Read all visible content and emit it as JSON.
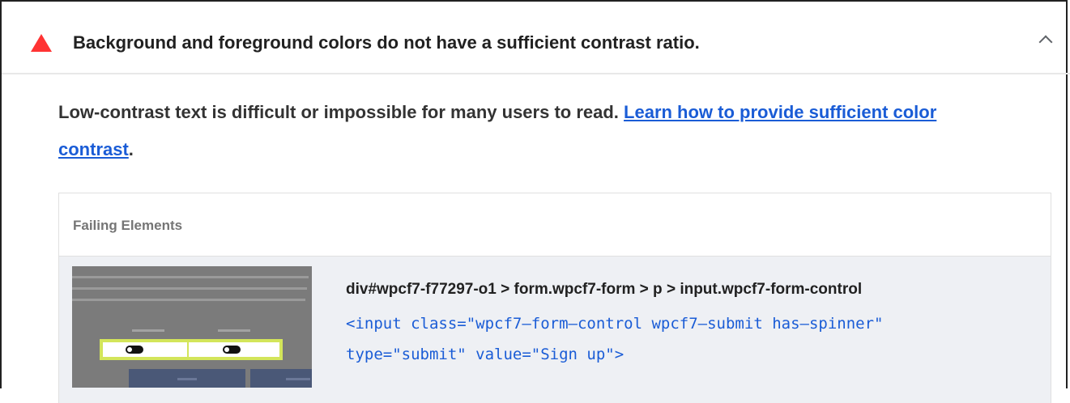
{
  "audit": {
    "title": "Background and foreground colors do not have a sufficient contrast ratio.",
    "status_icon": "fail-triangle-icon",
    "toggle_icon": "chevron-up-icon",
    "colors": {
      "fail": "#ff3333",
      "link": "#1a5cd6",
      "highlight": "#d3e55a"
    }
  },
  "description": {
    "text": "Low-contrast text is difficult or impossible for many users to read. ",
    "link_text": "Learn how to provide sufficient color contrast",
    "suffix": "."
  },
  "failing_elements": {
    "heading": "Failing Elements",
    "items": [
      {
        "selector": "div#wpcf7-f77297-o1 > form.wpcf7-form > p > input.wpcf7-form-control",
        "snippet": "<input class=\"wpcf7–form–control wpcf7–submit has–spinner\"\ntype=\"submit\" value=\"Sign up\">",
        "thumbnail": "element-screenshot-thumbnail"
      }
    ]
  }
}
